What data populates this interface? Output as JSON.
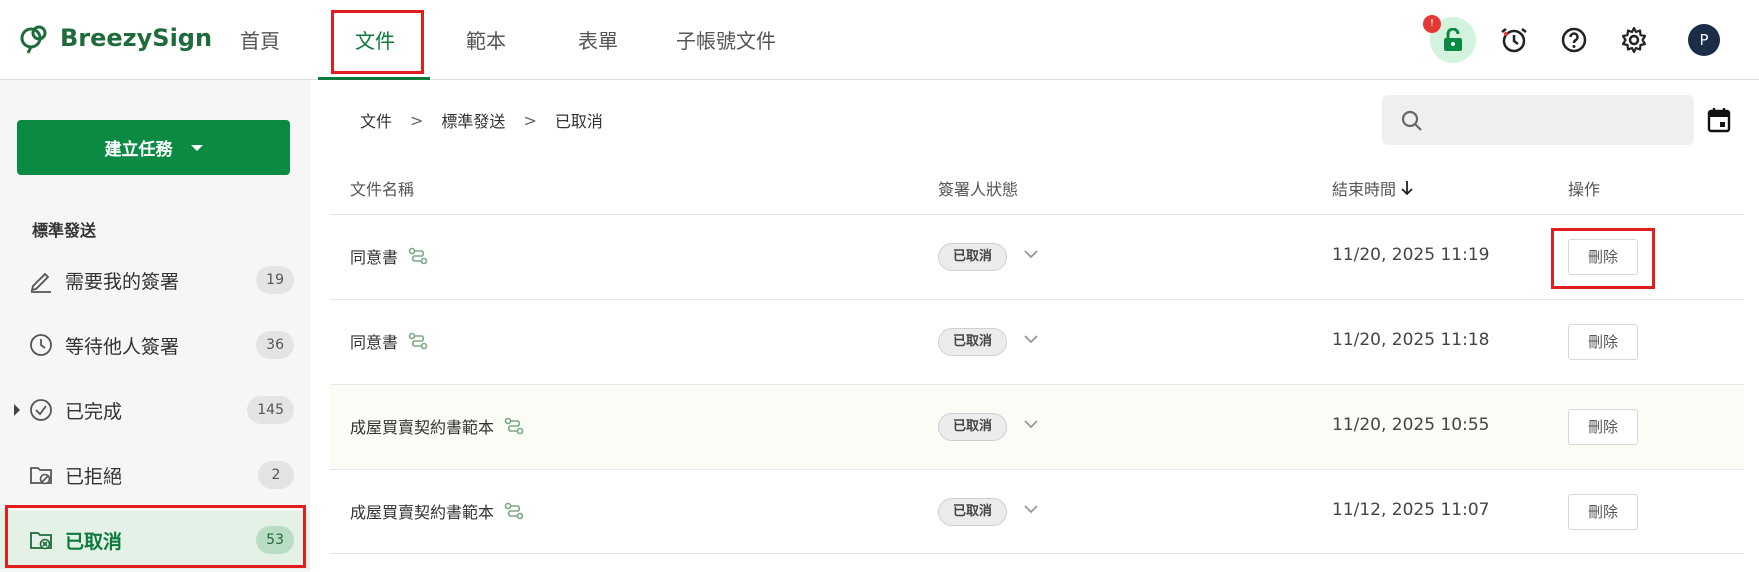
{
  "app": {
    "name": "BreezySign",
    "avatar_initial": "P",
    "notification_badge": "!"
  },
  "nav": {
    "items": [
      {
        "label": "首頁"
      },
      {
        "label": "文件"
      },
      {
        "label": "範本"
      },
      {
        "label": "表單"
      },
      {
        "label": "子帳號文件"
      }
    ],
    "active": "文件"
  },
  "header_icons": [
    "lock-icon",
    "history-icon",
    "help-icon",
    "gear-icon",
    "avatar"
  ],
  "sidebar": {
    "create_button": "建立任務",
    "section_heading": "標準發送",
    "items": [
      {
        "label": "需要我的簽署",
        "count": "19",
        "icon": "pen-icon"
      },
      {
        "label": "等待他人簽署",
        "count": "36",
        "icon": "clock-icon"
      },
      {
        "label": "已完成",
        "count": "145",
        "icon": "check-circle-icon"
      },
      {
        "label": "已拒絕",
        "count": "2",
        "icon": "folder-reject-icon"
      },
      {
        "label": "已取消",
        "count": "53",
        "icon": "folder-cancel-icon"
      }
    ],
    "active": "已取消"
  },
  "breadcrumb": {
    "items": [
      "文件",
      "標準發送",
      "已取消"
    ],
    "separator": ">"
  },
  "search": {
    "placeholder": ""
  },
  "table": {
    "headers": {
      "name": "文件名稱",
      "status": "簽署人狀態",
      "end_time": "結束時間",
      "action": "操作"
    },
    "rows": [
      {
        "name": "同意書",
        "status": "已取消",
        "end_time": "11/20, 2025 11:19",
        "action": "刪除"
      },
      {
        "name": "同意書",
        "status": "已取消",
        "end_time": "11/20, 2025 11:18",
        "action": "刪除"
      },
      {
        "name": "成屋買賣契約書範本",
        "status": "已取消",
        "end_time": "11/20, 2025 10:55",
        "action": "刪除"
      },
      {
        "name": "成屋買賣契約書範本",
        "status": "已取消",
        "end_time": "11/12, 2025 11:07",
        "action": "刪除"
      }
    ]
  },
  "colors": {
    "brand": "#0b8a44",
    "brand_dark": "#1f6b3b",
    "highlight": "#e11d1d",
    "active_bg": "#e3f1e6"
  }
}
